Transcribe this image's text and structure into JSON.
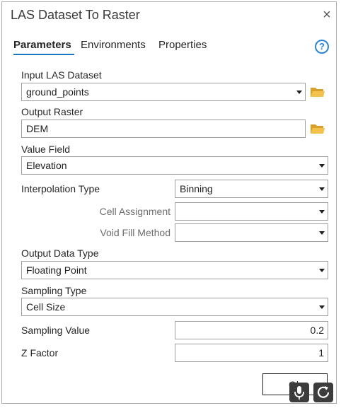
{
  "window": {
    "title": "LAS Dataset To Raster"
  },
  "tabs": [
    {
      "label": "Parameters",
      "active": true
    },
    {
      "label": "Environments",
      "active": false
    },
    {
      "label": "Properties",
      "active": false
    }
  ],
  "help": {
    "glyph": "?",
    "icon": "help-icon"
  },
  "close": {
    "glyph": "×",
    "icon": "close-icon"
  },
  "params": {
    "input_las": {
      "label": "Input LAS Dataset",
      "value": "ground_points"
    },
    "output_raster": {
      "label": "Output Raster",
      "value": "DEM"
    },
    "value_field": {
      "label": "Value Field",
      "value": "Elevation"
    },
    "interpolation_type": {
      "label": "Interpolation Type",
      "value": "Binning"
    },
    "cell_assignment": {
      "label": "Cell Assignment",
      "value": ""
    },
    "void_fill": {
      "label": "Void Fill Method",
      "value": ""
    },
    "output_data_type": {
      "label": "Output Data Type",
      "value": "Floating Point"
    },
    "sampling_type": {
      "label": "Sampling Type",
      "value": "Cell Size"
    },
    "sampling_value": {
      "label": "Sampling Value",
      "value": "0.2"
    },
    "z_factor": {
      "label": "Z Factor",
      "value": "1"
    }
  },
  "run_button": {
    "label": "Ok"
  },
  "colors": {
    "accent": "#1a76c2",
    "folder": "#e6b23c",
    "overlay": "#3c3c3c"
  }
}
